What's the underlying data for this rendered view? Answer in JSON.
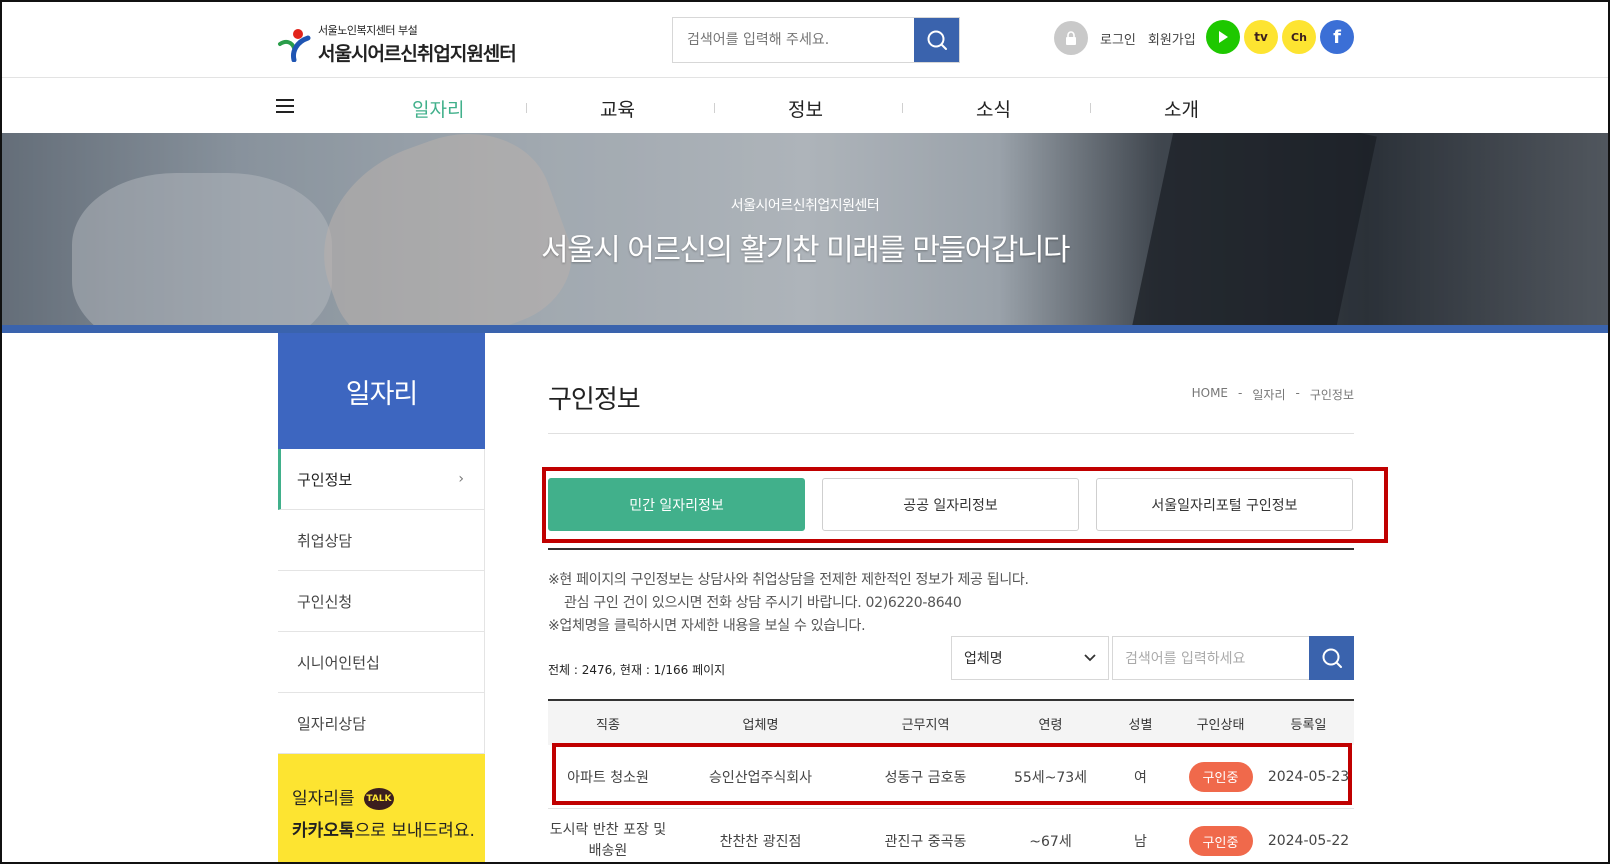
{
  "header": {
    "logo_small": "서울노인복지센터 부설",
    "logo_big": "서울시어르신취업지원센터",
    "search_placeholder": "검색어를 입력해 주세요.",
    "login": "로그인",
    "signup": "회원가입",
    "sns": [
      "youtube-play",
      "kakao-tv",
      "kakao-channel",
      "facebook"
    ],
    "sns_tv_label": "tv",
    "sns_ch_label": "Ch",
    "sns_fb_label": "f"
  },
  "gnb": {
    "items": [
      "일자리",
      "교육",
      "정보",
      "소식",
      "소개"
    ]
  },
  "banner": {
    "sub": "서울시어르신취업지원센터",
    "main": "서울시 어르신의 활기찬 미래를 만들어갑니다"
  },
  "sidebar": {
    "title": "일자리",
    "items": [
      "구인정보",
      "취업상담",
      "구인신청",
      "시니어인턴십",
      "일자리상담"
    ],
    "kakao_line1": "일자리를",
    "kakao_talk": "TALK",
    "kakao_line2_bold": "카카오톡",
    "kakao_line2_rest": "으로 보내드려요."
  },
  "content": {
    "title": "구인정보",
    "breadcrumb": [
      "HOME",
      "-",
      "일자리",
      "-",
      "구인정보"
    ],
    "tabs": [
      "민간 일자리정보",
      "공공 일자리정보",
      "서울일자리포털 구인정보"
    ],
    "notice": [
      "※현 페이지의 구인정보는 상담사와 취업상담을 전제한 제한적인 정보가 제공 됩니다.",
      "관심 구인 건이 있으시면 전화 상담 주시기 바랍니다. 02)6220-8640",
      "※업체명을 클릭하시면 자세한 내용을 보실 수 있습니다."
    ],
    "total": "전체 : 2476, 현재 : 1/166 페이지",
    "select_value": "업체명",
    "search_placeholder": "검색어를 입력하세요"
  },
  "table": {
    "headers": [
      "직종",
      "업체명",
      "근무지역",
      "연령",
      "성별",
      "구인상태",
      "등록일"
    ],
    "rows": [
      [
        "아파트 청소원",
        "승인산업주식회사",
        "성동구 금호동",
        "55세~73세",
        "여",
        "구인중",
        "2024-05-23"
      ],
      [
        "도시락 반찬 포장 및 배송원",
        "찬찬찬 광진점",
        "관진구 중곡동",
        "~67세",
        "남",
        "구인중",
        "2024-05-22"
      ]
    ]
  },
  "colors": {
    "accent_green": "#41b08b",
    "brand_blue": "#3a63ad",
    "sidebar_blue": "#3d66c0",
    "badge_orange": "#f0694b",
    "highlight_red": "#c00000",
    "kakao_yellow": "#fde431"
  }
}
